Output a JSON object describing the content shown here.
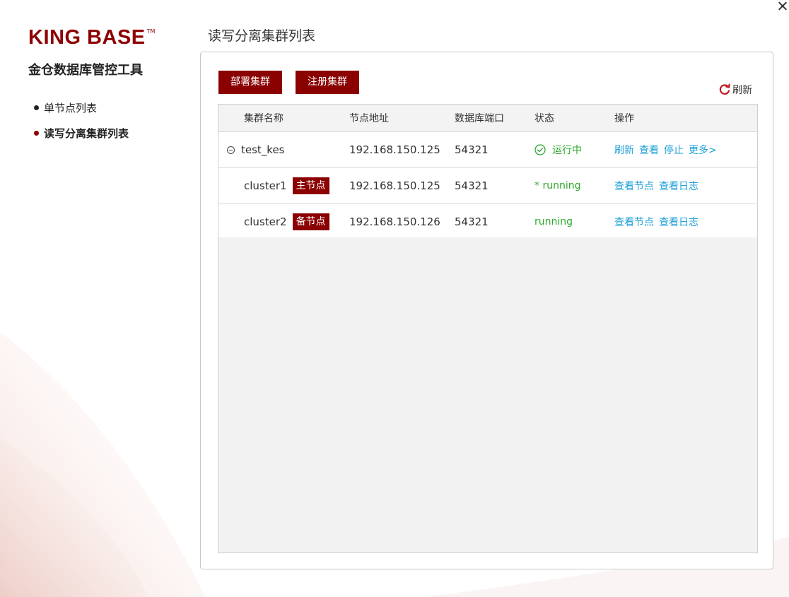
{
  "brand": {
    "logo_text": "KING BASE",
    "logo_tm": "TM",
    "subtitle": "金仓数据库管控工具"
  },
  "sidebar": {
    "items": [
      {
        "label": "单节点列表",
        "active": false
      },
      {
        "label": "读写分离集群列表",
        "active": true
      }
    ]
  },
  "page": {
    "title": "读写分离集群列表"
  },
  "toolbar": {
    "deploy_label": "部署集群",
    "register_label": "注册集群",
    "refresh_label": "刷新"
  },
  "table": {
    "headers": {
      "name": "集群名称",
      "address": "节点地址",
      "port": "数据库端口",
      "status": "状态",
      "ops": "操作"
    },
    "rows": [
      {
        "name": "test_kes",
        "address": "192.168.150.125",
        "port": "54321",
        "status": "运行中",
        "ops": [
          "刷新",
          "查看",
          "停止",
          "更多>"
        ]
      },
      {
        "name": "cluster1",
        "role": "主节点",
        "address": "192.168.150.125",
        "port": "54321",
        "status": "* running",
        "ops": [
          "查看节点",
          "查看日志"
        ]
      },
      {
        "name": "cluster2",
        "role": "备节点",
        "address": "192.168.150.126",
        "port": "54321",
        "status": "running",
        "ops": [
          "查看节点",
          "查看日志"
        ]
      }
    ]
  },
  "colors": {
    "brand": "#8e0000",
    "button": "#8b0000",
    "link": "#1e9fd8",
    "status_ok": "#2ea82e"
  },
  "icons": [
    "close-icon",
    "expand-collapse-icon",
    "check-circle-icon",
    "refresh-icon"
  ]
}
